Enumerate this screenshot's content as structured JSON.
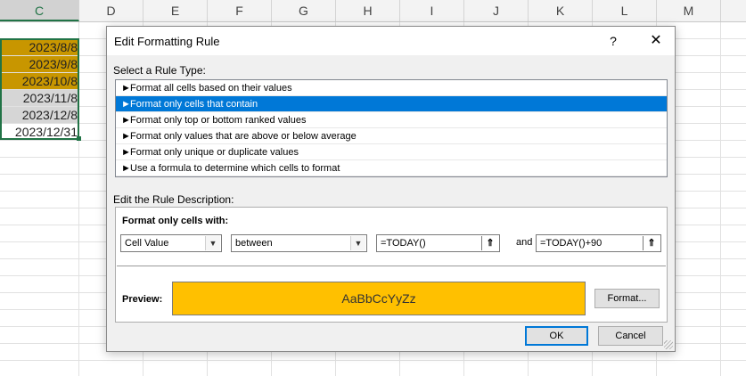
{
  "spreadsheet": {
    "columns": [
      "C",
      "D",
      "E",
      "F",
      "G",
      "H",
      "I",
      "J",
      "K",
      "L",
      "M"
    ],
    "selected_column": "C",
    "cells": [
      {
        "value": "2023/8/8",
        "fill": "#c89600"
      },
      {
        "value": "2023/9/8",
        "fill": "#c89600"
      },
      {
        "value": "2023/10/8",
        "fill": "#c89600"
      },
      {
        "value": "2023/11/8",
        "fill": "#d6d6d6"
      },
      {
        "value": "2023/12/8",
        "fill": "#d6d6d6"
      },
      {
        "value": "2023/12/31",
        "fill": "#ffffff"
      }
    ]
  },
  "dialog": {
    "title": "Edit Formatting Rule",
    "help_label": "?",
    "close_label": "✕",
    "select_rule_type_label": "Select a Rule Type:",
    "rule_types": [
      "Format all cells based on their values",
      "Format only cells that contain",
      "Format only top or bottom ranked values",
      "Format only values that are above or below average",
      "Format only unique or duplicate values",
      "Use a formula to determine which cells to format"
    ],
    "selected_rule_index": 1,
    "rule_arrow": "►",
    "edit_description_label": "Edit the Rule Description:",
    "format_only_cells_with_label": "Format only cells with:",
    "condition_type": "Cell Value",
    "operator": "between",
    "value1": "=TODAY()",
    "and_label": "and",
    "value2": "=TODAY()+90",
    "ref_icon_glyph": "⇑",
    "dropdown_glyph": "▼",
    "preview_label": "Preview:",
    "preview_text": "AaBbCcYyZz",
    "preview_fill": "#ffc000",
    "format_button_label": "Format...",
    "ok_label": "OK",
    "cancel_label": "Cancel"
  }
}
